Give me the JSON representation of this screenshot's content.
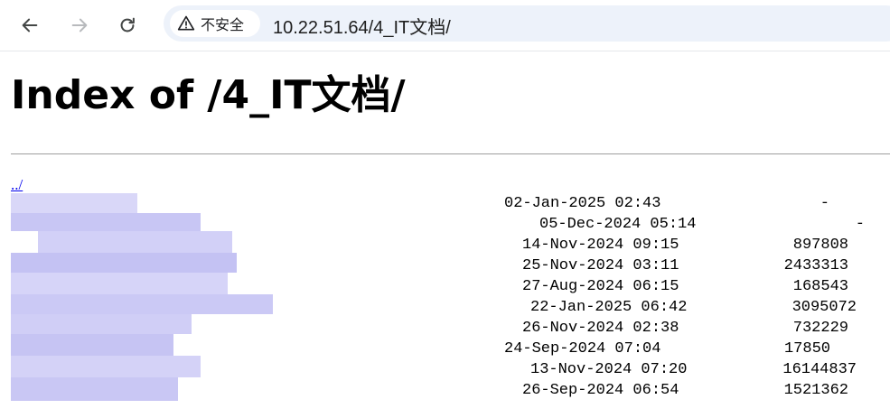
{
  "browser": {
    "security_label": "不安全",
    "url": "10.22.51.64/4_IT文档/"
  },
  "page": {
    "title": "Index of /4_IT文档/",
    "parent_link": "../"
  },
  "listing": [
    {
      "date": "02-Jan-2025 02:43",
      "size": "-"
    },
    {
      "date": "05-Dec-2024 05:14",
      "size": "-"
    },
    {
      "date": "14-Nov-2024 09:15",
      "size": "897808"
    },
    {
      "date": "25-Nov-2024 03:11",
      "size": "2433313"
    },
    {
      "date": "27-Aug-2024 06:15",
      "size": "168543"
    },
    {
      "date": "22-Jan-2025 06:42",
      "size": "3095072"
    },
    {
      "date": "26-Nov-2024 02:38",
      "size": "732229"
    },
    {
      "date": "24-Sep-2024 07:04",
      "size": "17850"
    },
    {
      "date": "13-Nov-2024 07:20",
      "size": "16144837"
    },
    {
      "date": "26-Sep-2024 06:54",
      "size": "1521362"
    }
  ]
}
